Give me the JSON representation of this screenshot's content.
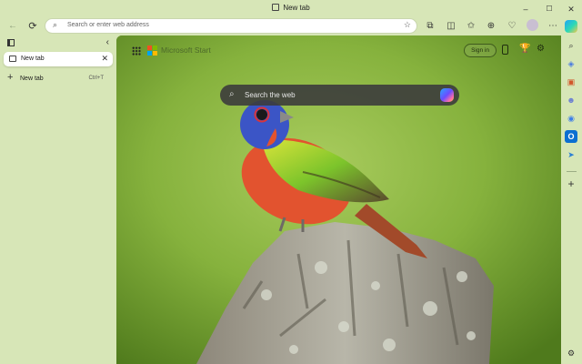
{
  "window": {
    "title": "New tab",
    "controls": [
      "–",
      "☐",
      "✕"
    ]
  },
  "toolbar": {
    "back_icon": "←",
    "refresh_icon": "⟳",
    "search_icon": "⌕",
    "address_placeholder": "Search or enter web address",
    "favorite_icon": "☆",
    "extensions_icon": "⧉",
    "split_icon": "◫",
    "favorites_icon": "✩",
    "collections_icon": "⊕",
    "performance_icon": "♡",
    "more_icon": "⋯"
  },
  "sidebar": {
    "collapse_icon": "‹",
    "tabs": [
      {
        "label": "New tab",
        "close": "✕"
      }
    ],
    "new_tab": {
      "plus": "+",
      "label": "New tab",
      "shortcut": "Ctrl+T"
    }
  },
  "newtab": {
    "brand": "Microsoft Start",
    "sign_in": "Sign in",
    "rewards_icon": "🏆",
    "settings_icon": "⚙",
    "search_icon": "⌕",
    "search_placeholder": "Search the web"
  },
  "rail": {
    "search_icon": "⌕",
    "tag_icon": "◈",
    "bag_icon": "▣",
    "people_icon": "☻",
    "drop_icon": "◉",
    "outlook_icon": "O",
    "send_icon": "➤",
    "add_icon": "+",
    "settings_icon": "⚙"
  },
  "colors": {
    "frame": "#d7e6b7",
    "accent_blue": "#0b6fd1",
    "bird_head": "#3b55c6",
    "bird_chest": "#e2532f",
    "bird_wing": "#8fcf2e"
  }
}
